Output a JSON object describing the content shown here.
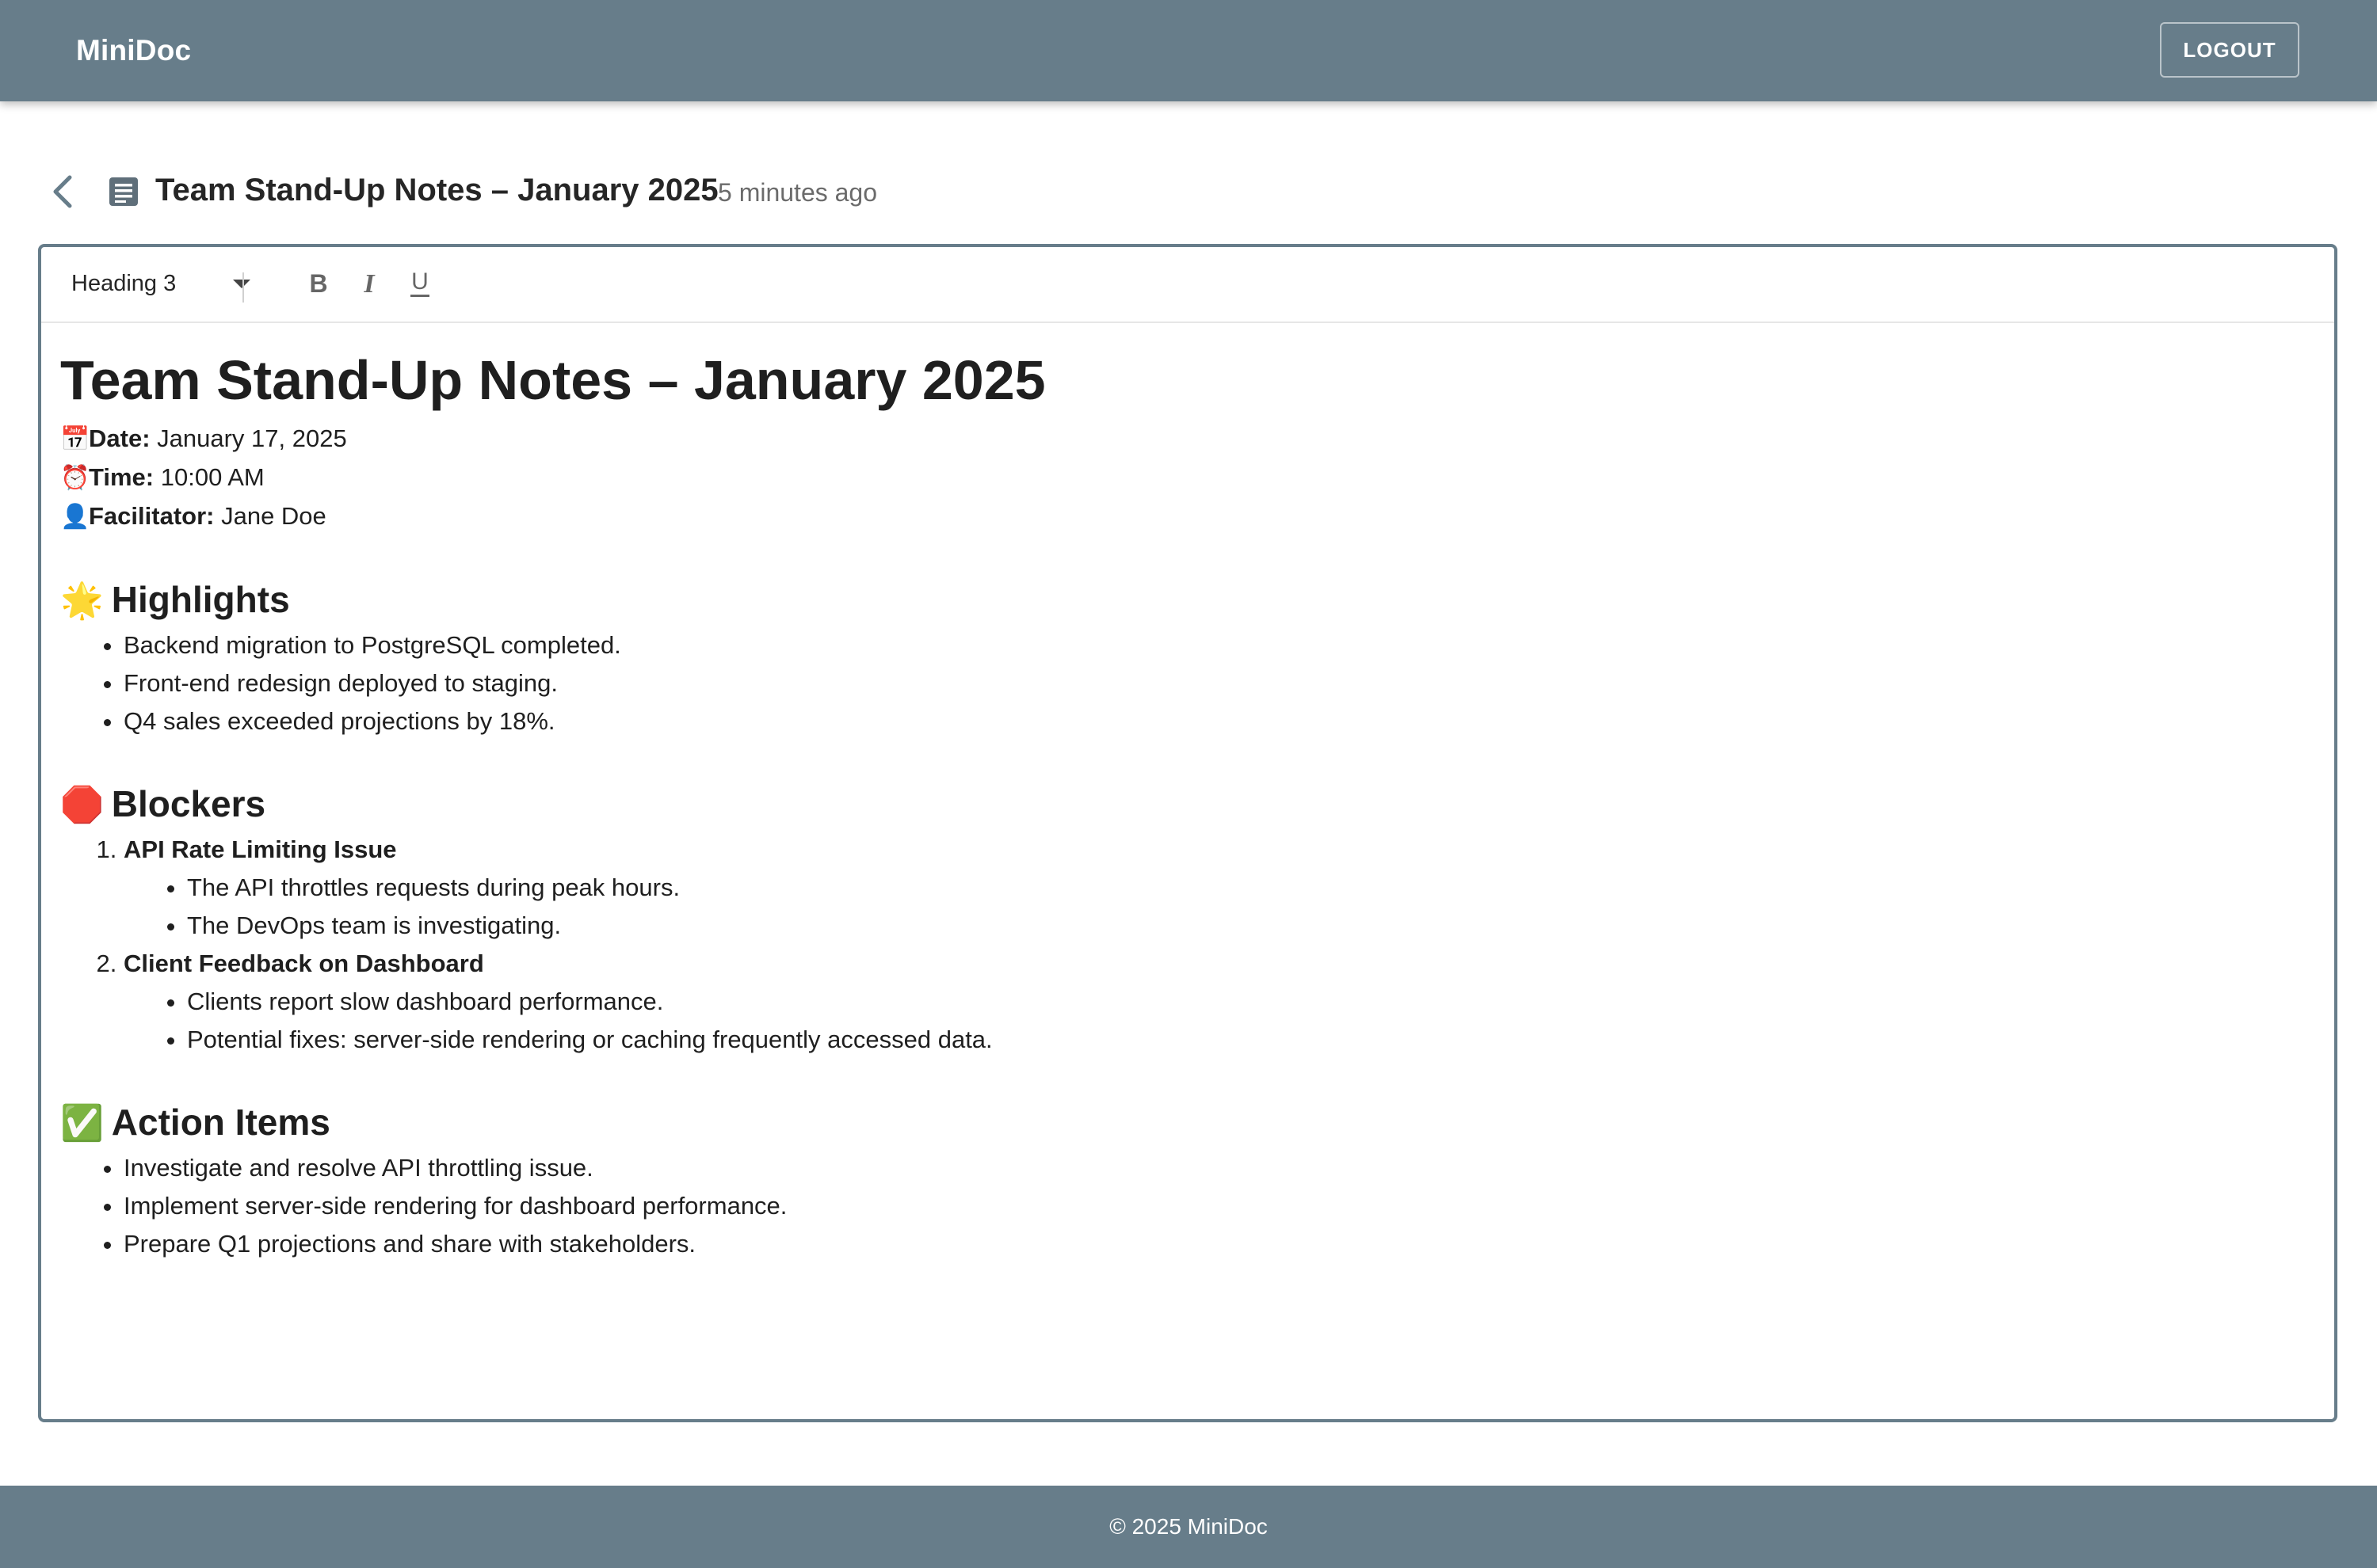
{
  "app": {
    "brand": "MiniDoc",
    "logout_label": "LOGOUT"
  },
  "doc": {
    "title": "Team Stand-Up Notes – January 2025",
    "updated": "5 minutes ago"
  },
  "toolbar": {
    "block_type": "Heading 3",
    "bold_icon": "bold-icon",
    "italic_icon": "italic-icon",
    "underline_icon": "underline-icon"
  },
  "content": {
    "heading": "Team Stand-Up Notes – January 2025",
    "meta": [
      {
        "emoji": "📅",
        "label": "Date:",
        "value": " January 17, 2025"
      },
      {
        "emoji": "⏰",
        "label": "Time:",
        "value": " 10:00 AM"
      },
      {
        "emoji": "👤",
        "label": "Facilitator:",
        "value": " Jane Doe"
      }
    ],
    "highlights": {
      "emoji": "🌟",
      "title": "Highlights",
      "items": [
        "Backend migration to PostgreSQL completed.",
        "Front-end redesign deployed to staging.",
        "Q4 sales exceeded projections by 18%."
      ]
    },
    "blockers": {
      "emoji": "🛑",
      "title": "Blockers",
      "items": [
        {
          "title": "API Rate Limiting Issue",
          "sub": [
            "The API throttles requests during peak hours.",
            "The DevOps team is investigating."
          ]
        },
        {
          "title": "Client Feedback on Dashboard",
          "sub": [
            "Clients report slow dashboard performance.",
            "Potential fixes: server-side rendering or caching frequently accessed data."
          ]
        }
      ]
    },
    "actions": {
      "emoji": "✅",
      "title": "Action Items",
      "items": [
        "Investigate and resolve API throttling issue.",
        "Implement server-side rendering for dashboard performance.",
        "Prepare Q1 projections and share with stakeholders."
      ]
    }
  },
  "footer": {
    "text": "© 2025 MiniDoc"
  },
  "colors": {
    "primary": "#677d8a",
    "text": "#1f1f1f",
    "muted": "#6b6b6b"
  }
}
